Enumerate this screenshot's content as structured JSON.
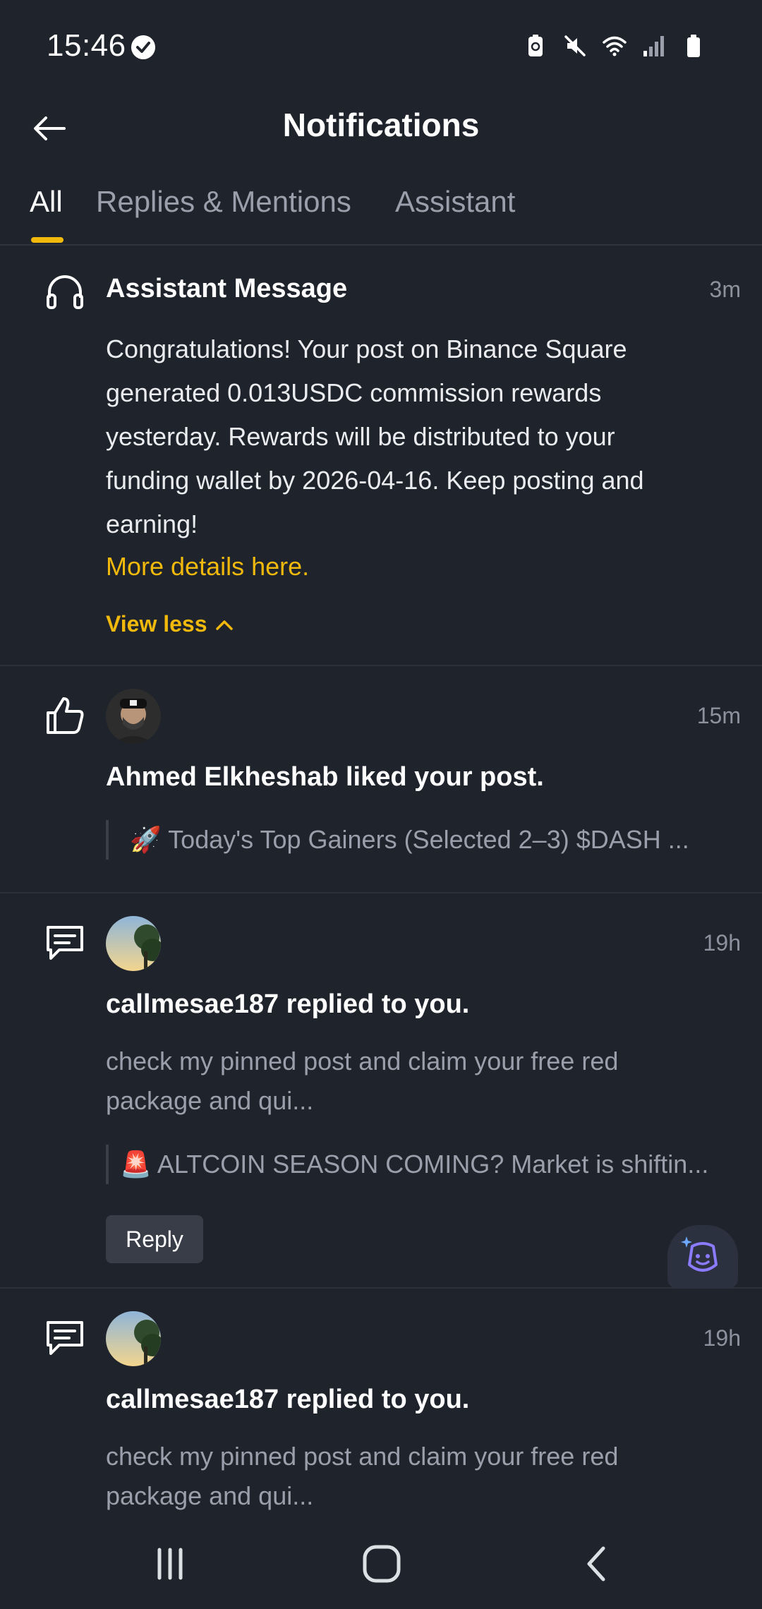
{
  "status_bar": {
    "time": "15:46",
    "icons": [
      "verified-check-icon",
      "battery-saver-icon",
      "mute-icon",
      "wifi-icon",
      "signal-icon",
      "battery-icon"
    ]
  },
  "header": {
    "title": "Notifications",
    "back_icon": "arrow-left-icon"
  },
  "tabs": [
    {
      "label": "All",
      "active": true
    },
    {
      "label": "Replies & Mentions",
      "active": false
    },
    {
      "label": "Assistant",
      "active": false
    }
  ],
  "colors": {
    "background": "#1f232b",
    "accent": "#f0b90b",
    "text_primary": "#eaecef",
    "text_secondary": "#9aa0ab"
  },
  "notifications": [
    {
      "type": "assistant",
      "icon": "headset-icon",
      "title": "Assistant Message",
      "time": "3m",
      "lines": [
        "Congratulations! Your post on Binance Square",
        "generated 0.013USDC commission rewards",
        "yesterday. Rewards will be distributed to your",
        "funding wallet by 2026-04-16. Keep posting and",
        "earning!"
      ],
      "link": "More details here.",
      "toggle": "View less"
    },
    {
      "type": "like",
      "icon": "thumbs-up-icon",
      "time": "15m",
      "headline": "Ahmed Elkheshab liked your post.",
      "quote": "🚀 Today's Top Gainers (Selected 2–3)   $DASH ..."
    },
    {
      "type": "reply",
      "icon": "comment-icon",
      "time": "19h",
      "headline": "callmesae187 replied to you.",
      "lines": [
        "check my pinned post and claim your free red",
        "package and qui..."
      ],
      "quote": "🚨 ALTCOIN SEASON COMING? Market is shiftin...",
      "reply_label": "Reply"
    },
    {
      "type": "reply",
      "icon": "comment-icon",
      "time": "19h",
      "headline": "callmesae187 replied to you.",
      "lines": [
        "check my pinned post and claim your free red",
        "package and qui..."
      ]
    }
  ],
  "nav_bar": {
    "buttons": [
      "recent-apps-icon",
      "home-icon",
      "back-icon"
    ]
  }
}
